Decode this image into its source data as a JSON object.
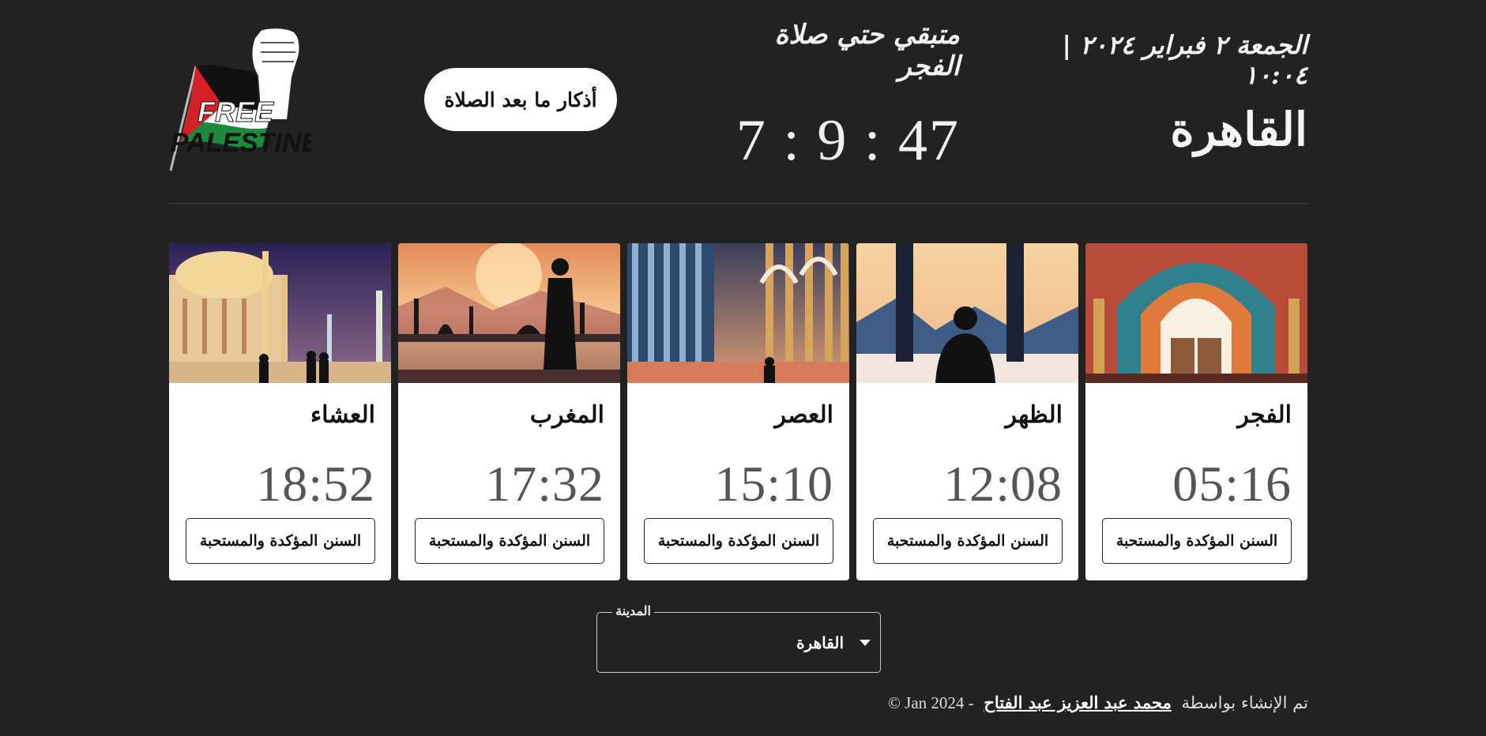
{
  "header": {
    "logo_text": "FREE PALESTINE",
    "azkar_button": "أذكار ما بعد الصلاة",
    "remaining_label": "متبقي حتي صلاة الفجر",
    "countdown": "7 : 9 : 47",
    "date_line": "الجمعة ٢ فبراير ٢٠٢٤ | ١٠:٠٤",
    "city": "القاهرة"
  },
  "prayers": [
    {
      "name": "العشاء",
      "time": "18:52",
      "button": "السنن المؤكدة والمستحبة",
      "image": "mosque-night-image"
    },
    {
      "name": "المغرب",
      "time": "17:32",
      "button": "السنن المؤكدة والمستحبة",
      "image": "sunset-silhouette-image"
    },
    {
      "name": "العصر",
      "time": "15:10",
      "button": "السنن المؤكدة والمستحبة",
      "image": "colonnade-image"
    },
    {
      "name": "الظهر",
      "time": "12:08",
      "button": "السنن المؤكدة والمستحبة",
      "image": "praying-window-image"
    },
    {
      "name": "الفجر",
      "time": "05:16",
      "button": "السنن المؤكدة والمستحبة",
      "image": "mosaic-arch-image"
    }
  ],
  "city_select": {
    "label": "المدينة",
    "value": "القاهرة"
  },
  "footer": {
    "prefix": "تم الإنشاء بواسطة",
    "author": "محمد عبد العزيز عبد الفتاح",
    "copyright": "© Jan 2024 -"
  },
  "colors": {
    "background": "#222222",
    "card": "#ffffff",
    "text_light": "#f5f5f5"
  }
}
